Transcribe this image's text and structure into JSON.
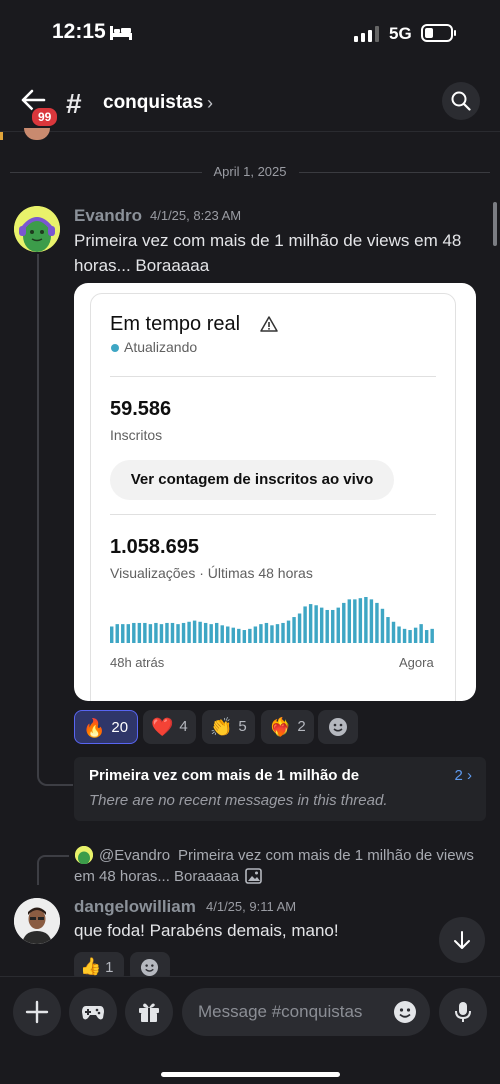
{
  "status": {
    "time": "12:15",
    "network": "5G"
  },
  "header": {
    "badge": "99",
    "channel": "conquistas"
  },
  "date_divider": "April 1, 2025",
  "message1": {
    "author": "Evandro",
    "timestamp": "4/1/25, 8:23 AM",
    "text_line1": "Primeira vez com mais de 1 milhão de views em 48",
    "text_line2": "horas... Boraaaaa"
  },
  "embed": {
    "title": "Em tempo real",
    "status": "Atualizando",
    "subscribers": "59.586",
    "subscribers_label": "Inscritos",
    "button": "Ver contagem de inscritos ao vivo",
    "views": "1.058.695",
    "views_label": "Visualizações · Últimas 48 horas",
    "axis_left": "48h atrás",
    "axis_right": "Agora",
    "bar_values": [
      14,
      16,
      16,
      16,
      17,
      17,
      17,
      16,
      17,
      16,
      17,
      17,
      16,
      17,
      18,
      19,
      18,
      17,
      16,
      17,
      15,
      14,
      13,
      12,
      11,
      12,
      14,
      16,
      17,
      15,
      16,
      17,
      19,
      22,
      25,
      31,
      33,
      32,
      30,
      28,
      28,
      30,
      34,
      37,
      37,
      38,
      39,
      37,
      34,
      29,
      22,
      18,
      14,
      12,
      11,
      13,
      16,
      11,
      12
    ]
  },
  "reactions": [
    {
      "emoji": "🔥",
      "count": "20",
      "me": true
    },
    {
      "emoji": "❤️",
      "count": "4",
      "me": false
    },
    {
      "emoji": "👏",
      "count": "5",
      "me": false
    },
    {
      "emoji": "❤️‍🔥",
      "count": "2",
      "me": false
    }
  ],
  "thread": {
    "title": "Primeira vez com mais de 1 milhão de",
    "count": "2 ›",
    "empty": "There are no recent messages in this thread."
  },
  "reply": {
    "author": "@Evandro",
    "text_line1": "Primeira vez com mais de 1 milhão de views",
    "text_line2": "em 48 horas... Boraaaaa"
  },
  "message2": {
    "author": "dangelowilliam",
    "timestamp": "4/1/25, 9:11 AM",
    "text": "que foda! Parabéns demais, mano!",
    "reaction_emoji": "👍",
    "reaction_count": "1"
  },
  "composer": {
    "placeholder": "Message #conquistas"
  },
  "colors": {
    "accent": "#5865f2",
    "chart_bar": "#3ea6c4",
    "badge": "#da373c"
  }
}
